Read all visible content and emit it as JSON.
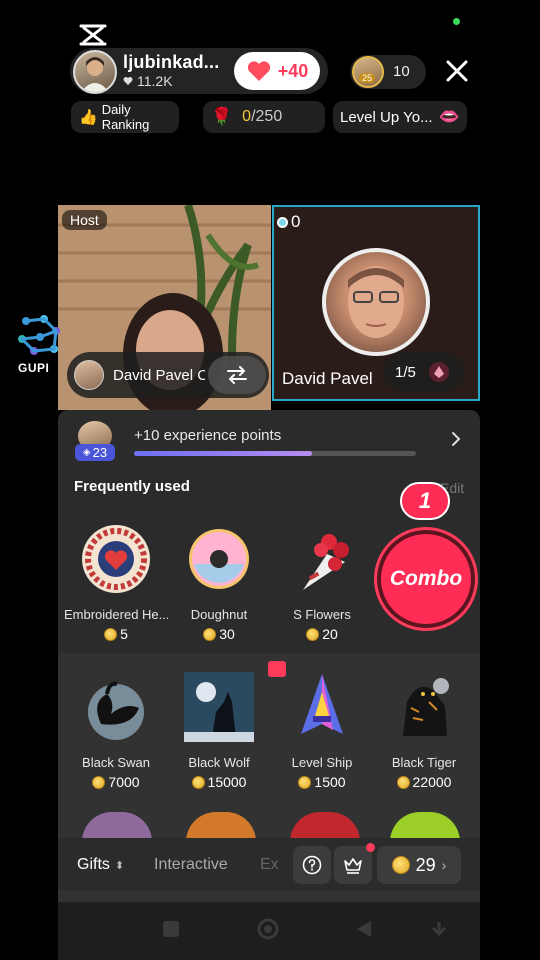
{
  "header": {
    "host_name": "ljubinkad...",
    "host_likes": "11.2K",
    "plus_label": "+40",
    "viewer_count": "10",
    "viewer_avatar_badge": "25"
  },
  "chips": {
    "daily_ranking": "Daily Ranking",
    "rose_progress_current": "0",
    "rose_progress_total": "/250",
    "level_up": "Level Up Yo..."
  },
  "battle": {
    "host_tag": "Host",
    "guest_score": "0",
    "left_name": "David Pavel C",
    "right_name": "David Pavel",
    "fraction": "1/5"
  },
  "watermark": {
    "text": "GUPI"
  },
  "xp": {
    "level": "23",
    "text": "+10 experience points",
    "progress": 0.63
  },
  "frequent": {
    "title": "Frequently used",
    "edit": "Edit",
    "combo_label": "Combo",
    "combo_count": "1",
    "items": [
      {
        "name": "Embroidered He...",
        "price": "5"
      },
      {
        "name": "Doughnut",
        "price": "30"
      },
      {
        "name": "S Flowers",
        "price": "20"
      }
    ]
  },
  "gifts": [
    {
      "name": "Black Swan",
      "price": "7000"
    },
    {
      "name": "Black Wolf",
      "price": "15000"
    },
    {
      "name": "Level Ship",
      "price": "1500"
    },
    {
      "name": "Black Tiger",
      "price": "22000"
    }
  ],
  "tabs": {
    "gifts": "Gifts",
    "interactive": "Interactive",
    "ex": "Ex",
    "balance": "29"
  },
  "colors": {
    "accent": "#ff2d55",
    "coin": "#f5c93c",
    "xp_fill": "#6d6ff5",
    "level_badge": "#4a55d8"
  }
}
